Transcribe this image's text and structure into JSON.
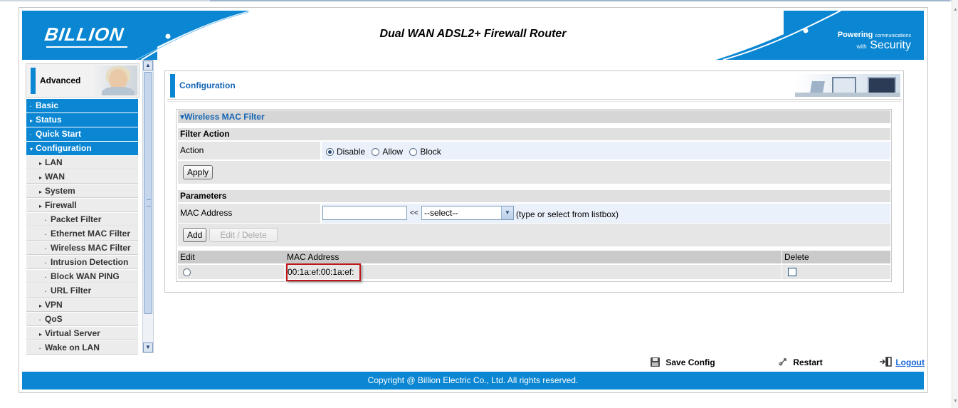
{
  "header": {
    "brand": "BILLION",
    "title": "Dual WAN ADSL2+ Firewall Router",
    "tagline_bold": "Powering",
    "tagline_small1": "communications",
    "tagline_small2": "with",
    "tagline_big": "Security"
  },
  "sidebar": {
    "mode_label": "Advanced",
    "items": [
      {
        "label": "Basic",
        "level": "main",
        "marker": "·"
      },
      {
        "label": "Status",
        "level": "main",
        "marker": "▸"
      },
      {
        "label": "Quick Start",
        "level": "main",
        "marker": "·"
      },
      {
        "label": "Configuration",
        "level": "main",
        "marker": "▾"
      },
      {
        "label": "LAN",
        "level": "sub",
        "marker": "▸"
      },
      {
        "label": "WAN",
        "level": "sub",
        "marker": "▸"
      },
      {
        "label": "System",
        "level": "sub",
        "marker": "▸"
      },
      {
        "label": "Firewall",
        "level": "sub",
        "marker": "▸"
      },
      {
        "label": "Packet Filter",
        "level": "sub2",
        "marker": "·"
      },
      {
        "label": "Ethernet MAC Filter",
        "level": "sub2",
        "marker": "·"
      },
      {
        "label": "Wireless MAC Filter",
        "level": "sub2",
        "marker": "·"
      },
      {
        "label": "Intrusion Detection",
        "level": "sub2",
        "marker": "·"
      },
      {
        "label": "Block WAN PING",
        "level": "sub2",
        "marker": "·"
      },
      {
        "label": "URL Filter",
        "level": "sub2",
        "marker": "·"
      },
      {
        "label": "VPN",
        "level": "sub",
        "marker": "▸"
      },
      {
        "label": "QoS",
        "level": "sub",
        "marker": "·"
      },
      {
        "label": "Virtual Server",
        "level": "sub",
        "marker": "▸"
      },
      {
        "label": "Wake on LAN",
        "level": "sub",
        "marker": "·"
      }
    ]
  },
  "page": {
    "title": "Configuration",
    "section_title": "▾Wireless MAC Filter",
    "filter_action": {
      "heading": "Filter Action",
      "action_label": "Action",
      "options": [
        "Disable",
        "Allow",
        "Block"
      ],
      "selected": "Disable",
      "apply_label": "Apply"
    },
    "parameters": {
      "heading": "Parameters",
      "mac_label": "MAC Address",
      "mac_value": "",
      "separator": "<<",
      "select_value": "--select--",
      "hint": "(type or select from listbox)",
      "add_label": "Add",
      "edit_delete_label": "Edit / Delete"
    },
    "table": {
      "columns": [
        "Edit",
        "MAC Address",
        "Delete"
      ],
      "rows": [
        {
          "mac": "00:1a:ef:00:1a:ef:"
        }
      ]
    }
  },
  "footer": {
    "save_label": "Save Config",
    "restart_label": "Restart",
    "logout_label": "Logout",
    "copyright": "Copyright @ Billion Electric Co., Ltd. All rights reserved."
  },
  "colors": {
    "brand_blue": "#0a86d2",
    "link_blue": "#1565b5",
    "highlight_red": "#c0171b"
  }
}
